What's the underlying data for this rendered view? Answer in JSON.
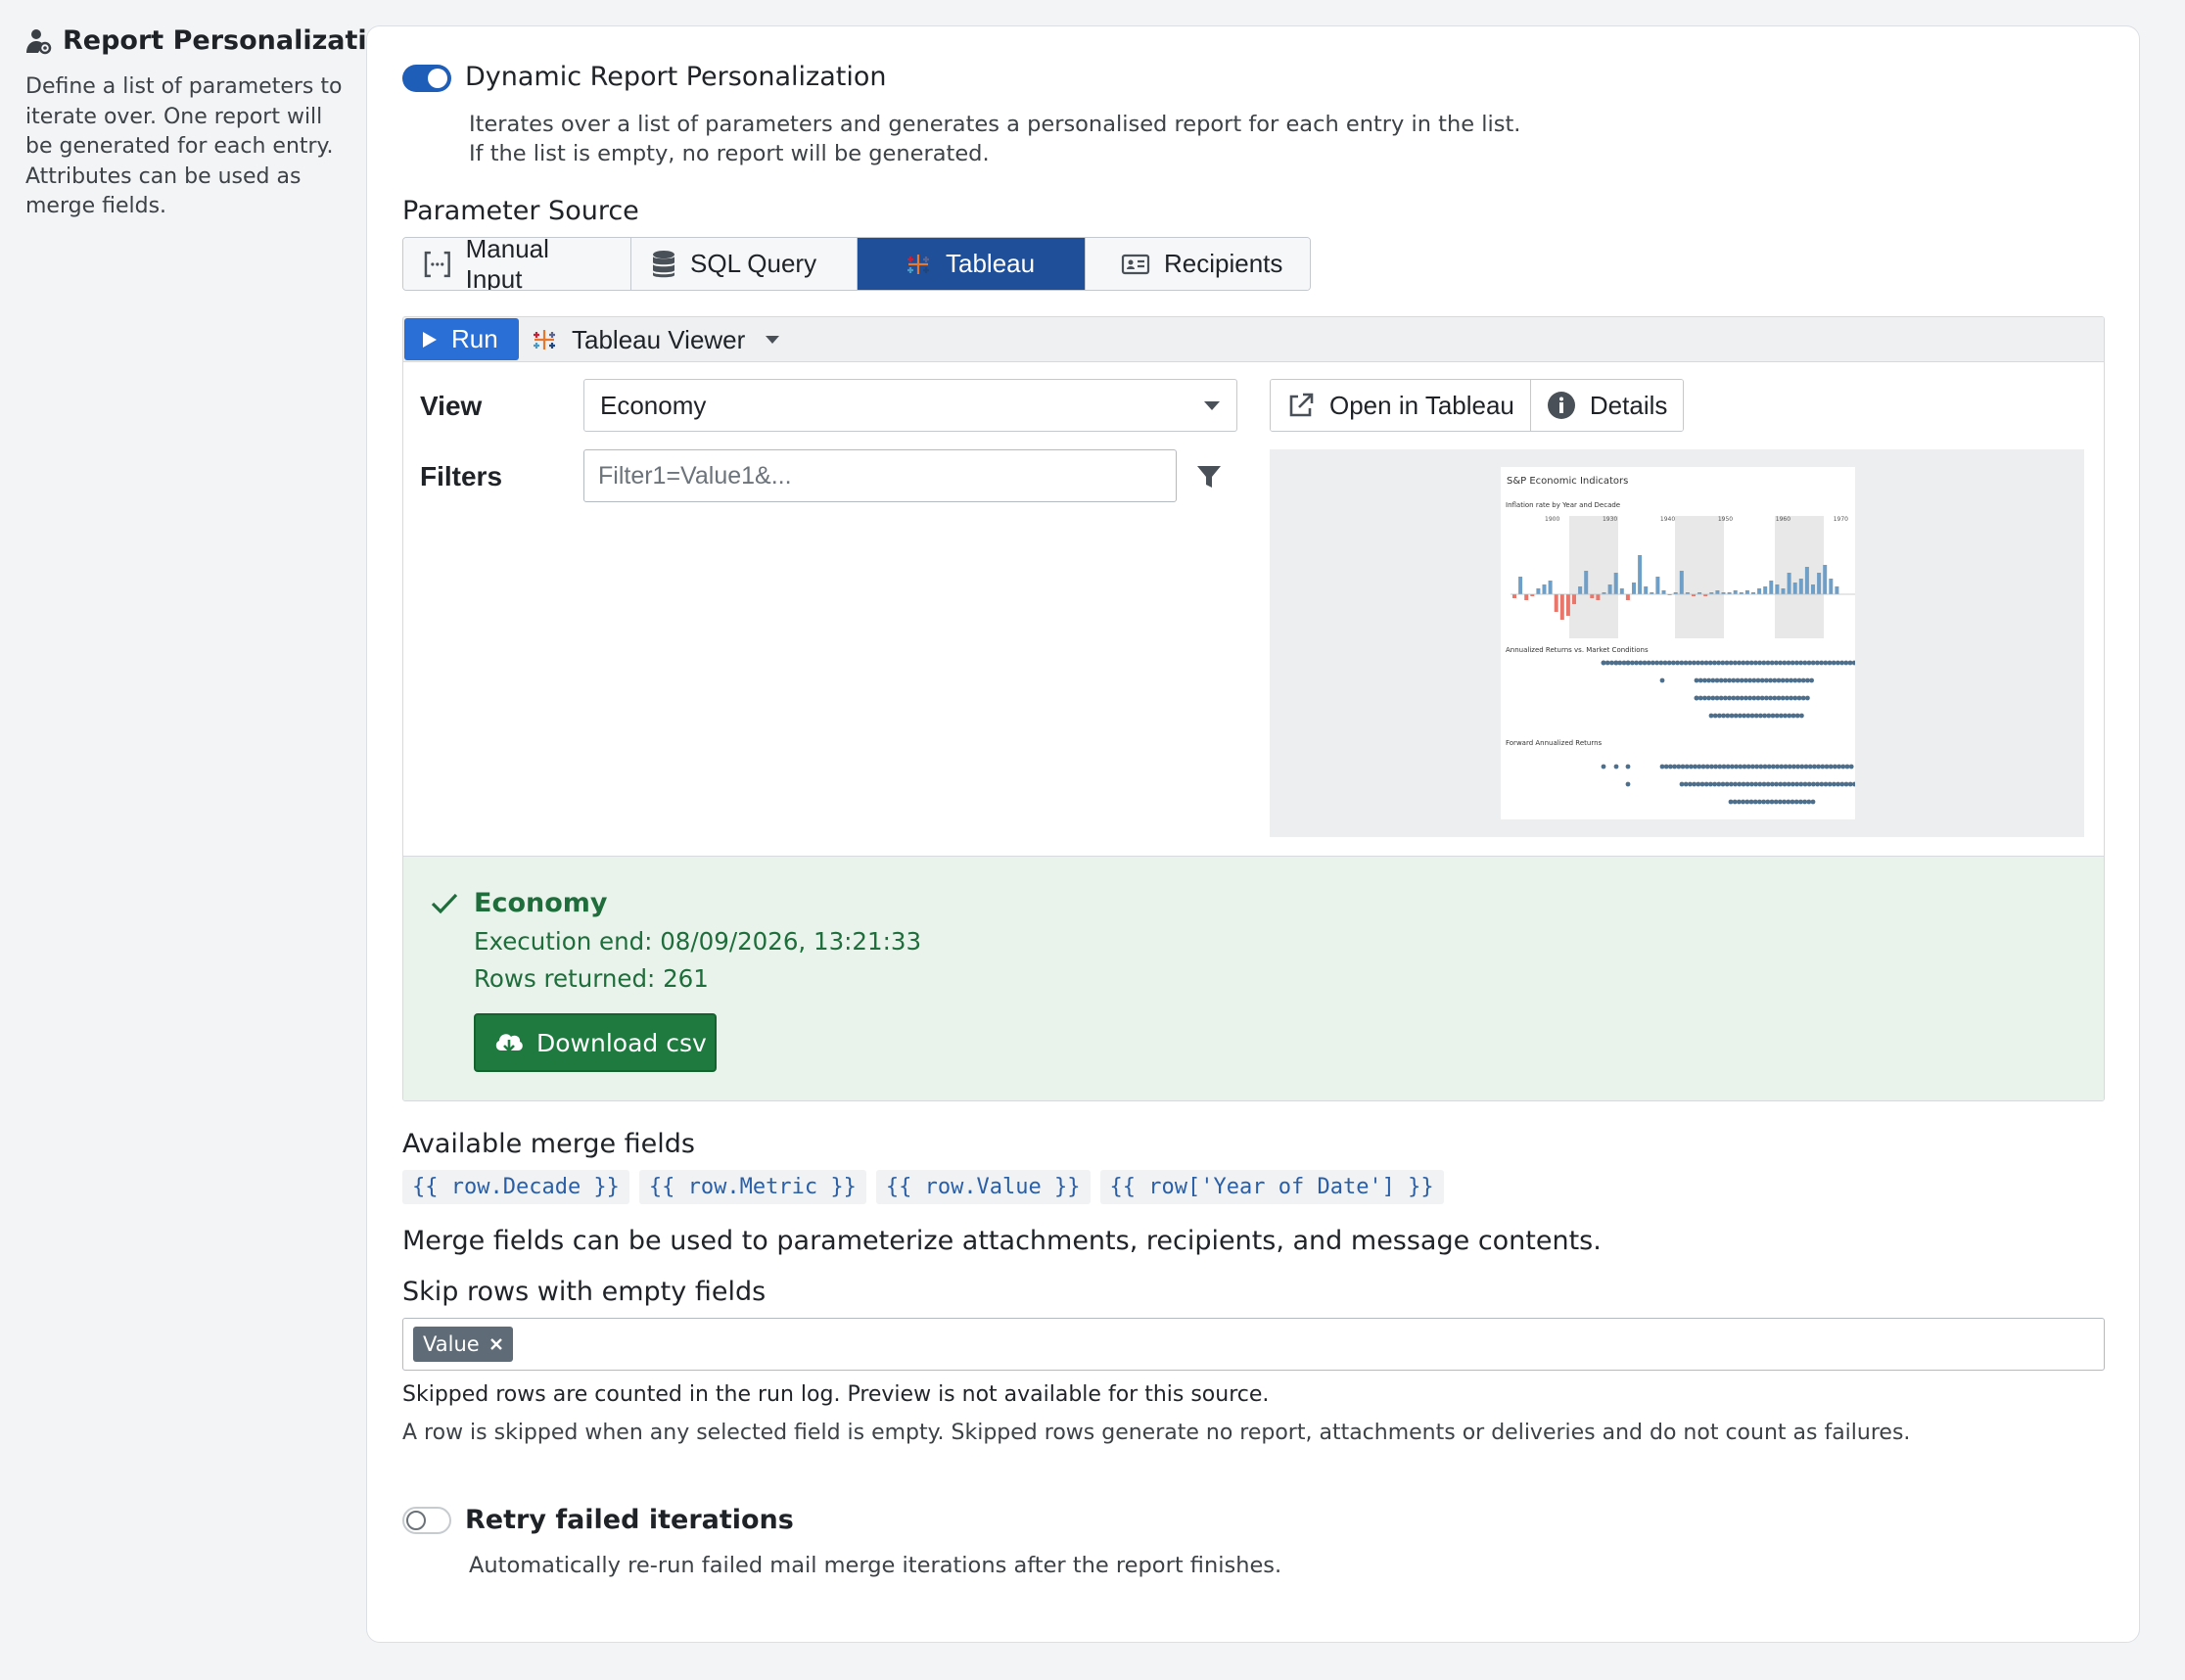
{
  "sidebar": {
    "title": "Report Personalization",
    "description": "Define a list of parameters to iterate over. One report will be generated for each entry. Attributes can be used as merge fields."
  },
  "dynamic": {
    "enabled": true,
    "label": "Dynamic Report Personalization",
    "help_line1": "Iterates over a list of parameters and generates a personalised report for each entry in the list.",
    "help_line2": "If the list is empty, no report will be generated."
  },
  "source": {
    "label": "Parameter Source",
    "tabs": [
      {
        "label": "Manual Input",
        "icon": "bracket-list-icon",
        "active": false
      },
      {
        "label": "SQL Query",
        "icon": "database-icon",
        "active": false
      },
      {
        "label": "Tableau",
        "icon": "tableau-icon",
        "active": true
      },
      {
        "label": "Recipients",
        "icon": "id-card-icon",
        "active": false
      }
    ]
  },
  "toolbar": {
    "run_label": "Run",
    "viewer_label": "Tableau Viewer"
  },
  "form": {
    "view_label": "View",
    "view_value": "Economy",
    "filters_label": "Filters",
    "filters_placeholder": "Filter1=Value1&...",
    "open_label": "Open in Tableau",
    "details_label": "Details"
  },
  "preview": {
    "title": "S&P Economic Indicators",
    "section1": "Inflation rate by Year and Decade",
    "section2": "Annualized Returns vs. Market Conditions",
    "section3": "Forward Annualized Returns",
    "decades": [
      "1900",
      "1930",
      "1940",
      "1950",
      "1960",
      "1970"
    ]
  },
  "result": {
    "title": "Economy",
    "execution_end": "Execution end: 08/09/2026, 13:21:33",
    "rows_returned": "Rows returned: 261",
    "download_label": "Download csv",
    "color": "#1e6d3a"
  },
  "merge": {
    "label": "Available merge fields",
    "fields": [
      "{{ row.Decade }}",
      "{{ row.Metric }}",
      "{{ row.Value }}",
      "{{ row['Year of Date'] }}"
    ],
    "note": "Merge fields can be used to parameterize attachments, recipients, and message contents."
  },
  "skip": {
    "label": "Skip rows with empty fields",
    "selected": [
      "Value"
    ],
    "note1": "Skipped rows are counted in the run log. Preview is not available for this source.",
    "note2": "A row is skipped when any selected field is empty. Skipped rows generate no report, attachments or deliveries and do not count as failures."
  },
  "retry": {
    "enabled": false,
    "label": "Retry failed iterations",
    "help": "Automatically re-run failed mail merge iterations after the report finishes."
  },
  "colors": {
    "primary": "#2a6fd6",
    "active_tab": "#1f4f99",
    "success": "#1e7a3f"
  }
}
